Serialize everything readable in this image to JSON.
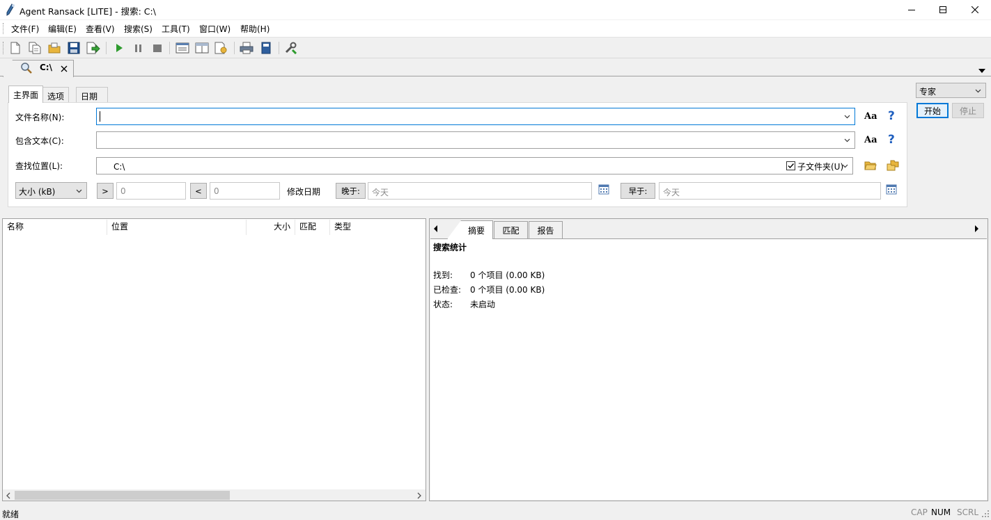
{
  "window": {
    "title": "Agent Ransack [LITE] - 搜索: C:\\"
  },
  "menu": [
    "文件(F)",
    "编辑(E)",
    "查看(V)",
    "搜索(S)",
    "工具(T)",
    "窗口(W)",
    "帮助(H)"
  ],
  "doc_tab": {
    "label": "C:\\"
  },
  "search_tabs": [
    "主界面",
    "选项",
    "日期"
  ],
  "form": {
    "filename_label": "文件名称(N):",
    "filename_value": "",
    "content_label": "包含文本(C):",
    "content_value": "",
    "location_label": "查找位置(L):",
    "location_value": "C:\\",
    "subfolders_label": "子文件夹(U)",
    "subfolders_checked": true,
    "case_label": "Aa",
    "help_label": "?",
    "size_unit": "大小 (kB)",
    "gt_label": ">",
    "gt_value": "0",
    "lt_label": "<",
    "lt_value": "0",
    "modified_label": "修改日期",
    "after_label": "晚于:",
    "after_value": "今天",
    "before_label": "早于:",
    "before_value": "今天"
  },
  "mode": "专家",
  "buttons": {
    "start": "开始",
    "stop": "停止"
  },
  "results": {
    "columns": [
      "名称",
      "位置",
      "大小",
      "匹配",
      "类型"
    ]
  },
  "right_tabs": [
    "摘要",
    "匹配",
    "报告"
  ],
  "summary": {
    "heading": "搜索统计",
    "rows": [
      {
        "label": "找到:",
        "value": "0 个项目 (0.00 KB)"
      },
      {
        "label": "已检查:",
        "value": "0 个项目 (0.00 KB)"
      },
      {
        "label": "状态:",
        "value": "未启动"
      }
    ]
  },
  "status": {
    "text": "就绪",
    "indicators": [
      "CAP",
      "NUM",
      "SCRL"
    ]
  },
  "colors": {
    "accent": "#0078d7",
    "help_blue": "#1f5fbf",
    "play_green": "#2e9b2e",
    "folder_yellow": "#e8b53d"
  }
}
